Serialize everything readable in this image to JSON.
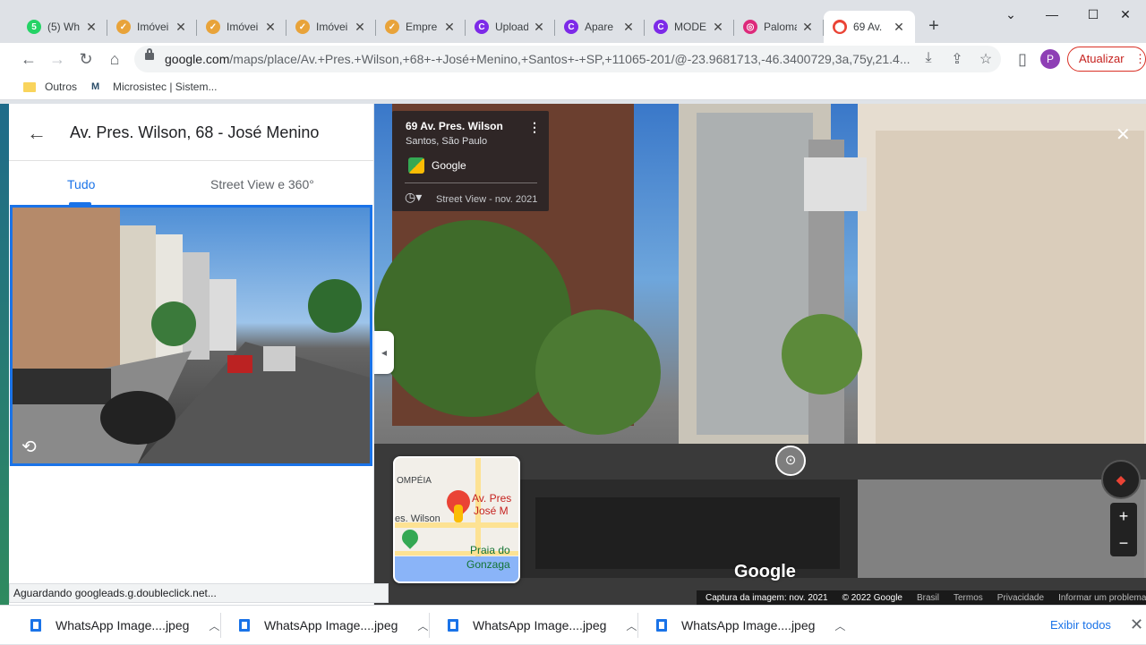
{
  "browser": {
    "tabs": [
      {
        "title": "(5) Wh",
        "favicon": "whatsapp-icon",
        "color": "#25d366",
        "glyph": "5"
      },
      {
        "title": "Imóvei",
        "favicon": "imoveis-icon",
        "color": "#e8a33a",
        "glyph": "✓"
      },
      {
        "title": "Imóvei",
        "favicon": "imoveis-icon",
        "color": "#e8a33a",
        "glyph": "✓"
      },
      {
        "title": "Imóvei",
        "favicon": "imoveis-icon",
        "color": "#e8a33a",
        "glyph": "✓"
      },
      {
        "title": "Empre",
        "favicon": "imoveis-icon",
        "color": "#e8a33a",
        "glyph": "✓"
      },
      {
        "title": "Upload",
        "favicon": "canva-icon",
        "color": "#7d2ae8",
        "glyph": "C"
      },
      {
        "title": "Apare",
        "favicon": "canva-icon",
        "color": "#7d2ae8",
        "glyph": "C"
      },
      {
        "title": "MODE",
        "favicon": "canva-icon",
        "color": "#7d2ae8",
        "glyph": "C"
      },
      {
        "title": "Paloma",
        "favicon": "instagram-icon",
        "color": "#dd2a7b",
        "glyph": "◎"
      },
      {
        "title": "69 Av.",
        "favicon": "maps-pin-icon",
        "color": "#ea4335",
        "glyph": "⬤",
        "active": true
      }
    ],
    "new_tab": "+",
    "window_controls": {
      "menu": "⌄",
      "minimize": "—",
      "maximize": "☐",
      "close": "✕"
    },
    "url_host": "google.com",
    "url_path": "/maps/place/Av.+Pres.+Wilson,+68+-+José+Menino,+Santos+-+SP,+11065-201/@-23.9681713,-46.3400729,3a,75y,21.4...",
    "profile_initial": "P",
    "update_label": "Atualizar",
    "bookmarks": [
      "Outros",
      "Microsistec | Sistem..."
    ]
  },
  "panel": {
    "title": "Av. Pres. Wilson, 68 - José Menino",
    "tabs": [
      "Tudo",
      "Street View e 360°"
    ],
    "active_tab": "Tudo"
  },
  "street_view": {
    "card_title": "69 Av. Pres. Wilson",
    "card_subtitle": "Santos, São Paulo",
    "card_source": "Google",
    "card_date": "Street View - nov. 2021",
    "watermark": "Google",
    "minimap": {
      "labels": [
        "OMPÉIA",
        "Av. Pres",
        "José M",
        "es. Wilson",
        "Praia do",
        "Gonzaga"
      ]
    },
    "footer": [
      "Captura da imagem: nov. 2021",
      "© 2022 Google",
      "Brasil",
      "Termos",
      "Privacidade",
      "Informar um problema"
    ]
  },
  "status_text": "Aguardando googleads.g.doubleclick.net...",
  "downloads": {
    "items": [
      "WhatsApp Image....jpeg",
      "WhatsApp Image....jpeg",
      "WhatsApp Image....jpeg",
      "WhatsApp Image....jpeg"
    ],
    "show_all": "Exibir todos"
  }
}
